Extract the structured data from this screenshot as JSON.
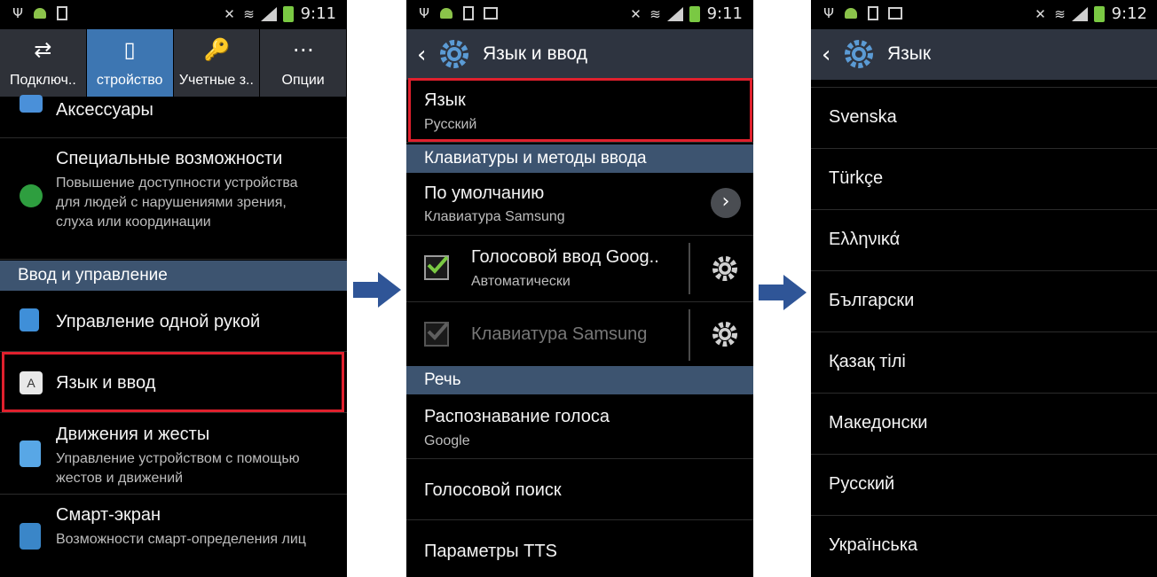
{
  "status": {
    "time_1": "9:11",
    "time_2": "9:11",
    "time_3": "9:12"
  },
  "screen1": {
    "tabs": [
      {
        "label": "Подключ..",
        "icon": "connections-icon"
      },
      {
        "label": "стройство",
        "icon": "device-icon"
      },
      {
        "label": "Учетные з..",
        "icon": "accounts-icon"
      },
      {
        "label": "Опции",
        "icon": "more-options-icon"
      }
    ],
    "accessories": "Аксессуары",
    "accessibility": {
      "title": "Специальные возможности",
      "sub": "Повышение доступности устройства для людей с нарушениями зрения, слуха или координации"
    },
    "section_input": "Ввод и управление",
    "one_hand": "Управление одной рукой",
    "lang_input": "Язык и ввод",
    "motions": {
      "title": "Движения и жесты",
      "sub": "Управление устройством с помощью жестов и движений"
    },
    "smart": {
      "title": "Смарт-экран",
      "sub": "Возможности смарт-определения лиц"
    }
  },
  "screen2": {
    "title": "Язык и ввод",
    "language": {
      "title": "Язык",
      "value": "Русский"
    },
    "section_keyboards": "Клавиатуры и методы ввода",
    "default": {
      "title": "По умолчанию",
      "value": "Клавиатура Samsung"
    },
    "voice_google": {
      "title": "Голосовой ввод Goog..",
      "value": "Автоматически"
    },
    "samsung_kb": "Клавиатура Samsung",
    "section_speech": "Речь",
    "voice_recognition": {
      "title": "Распознавание голоса",
      "value": "Google"
    },
    "voice_search": "Голосовой поиск",
    "tts": "Параметры TTS"
  },
  "screen3": {
    "title": "Язык",
    "languages": [
      "Svenska",
      "Türkçe",
      "Ελληνικά",
      "Български",
      "Қазақ тілі",
      "Македонски",
      "Русский",
      "Українська"
    ]
  },
  "colors": {
    "highlight": "#e0202d",
    "section": "#3d5470",
    "active_tab": "#3d76b2",
    "arrow": "#2f5597",
    "check": "#7ac943"
  }
}
